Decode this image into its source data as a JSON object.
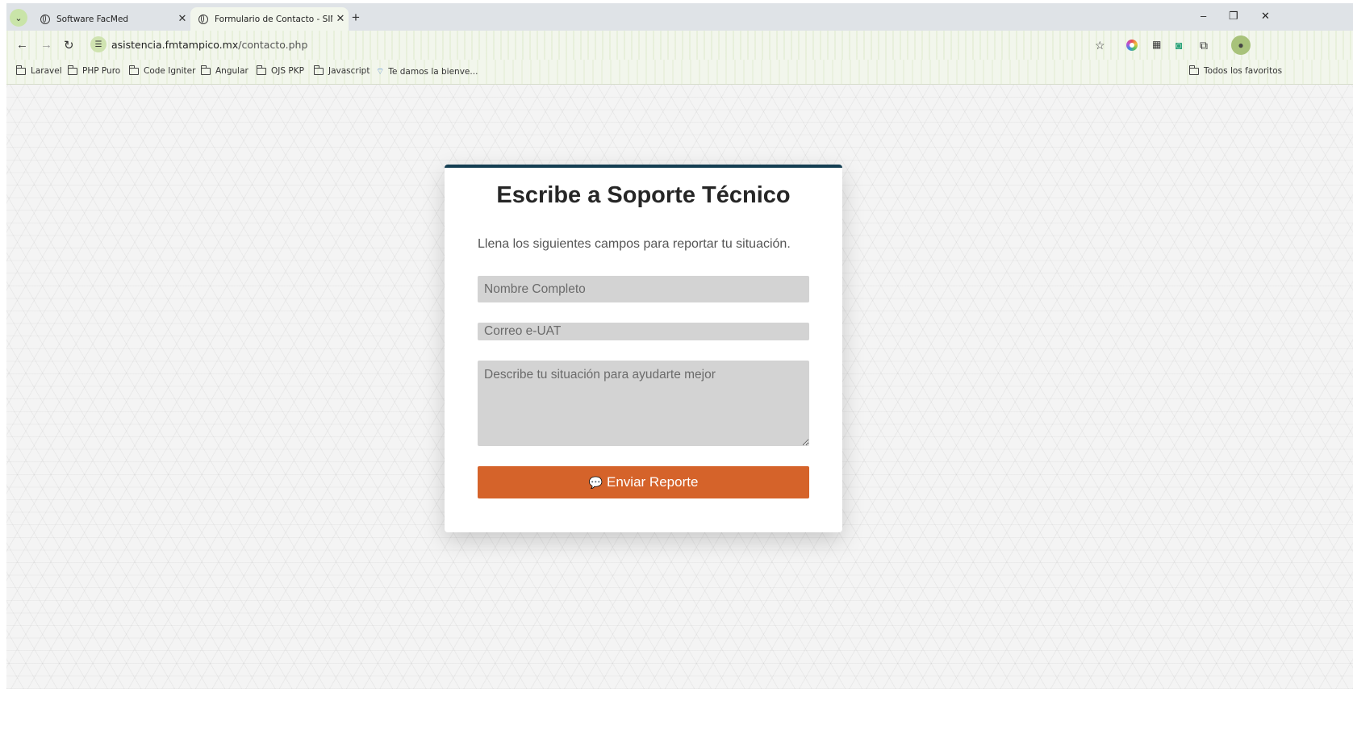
{
  "browser": {
    "tabs": [
      {
        "title": "Software FacMed",
        "active": false
      },
      {
        "title": "Formulario de Contacto - SIMP",
        "active": true
      }
    ],
    "url_domain": "asistencia.fmtampico.mx",
    "url_path": "/contacto.php",
    "bookmarks": [
      "Laravel",
      "PHP Puro",
      "Code Igniter",
      "Angular",
      "OJS PKP",
      "Javascript",
      "Te damos la bienve..."
    ],
    "bookmarks_right": "Todos los favoritos",
    "icons": [
      "tab-search-icon",
      "globe-icon",
      "close-icon",
      "new-tab-icon",
      "back-icon",
      "forward-icon",
      "reload-icon",
      "site-info-icon",
      "star-icon",
      "extension-icon",
      "avatar",
      "folder-icon",
      "wifi-icon",
      "minimize-icon",
      "restore-icon"
    ]
  },
  "form": {
    "title": "Escribe a Soporte Técnico",
    "intro": "Llena los siguientes campos para reportar tu situación.",
    "name_placeholder": "Nombre Completo",
    "email_placeholder": "Correo e-UAT",
    "desc_placeholder": "Describe tu situación para ayudarte mejor",
    "submit_label": "Enviar Reporte",
    "accent_color": "#d5632a",
    "header_color": "#143e52"
  }
}
